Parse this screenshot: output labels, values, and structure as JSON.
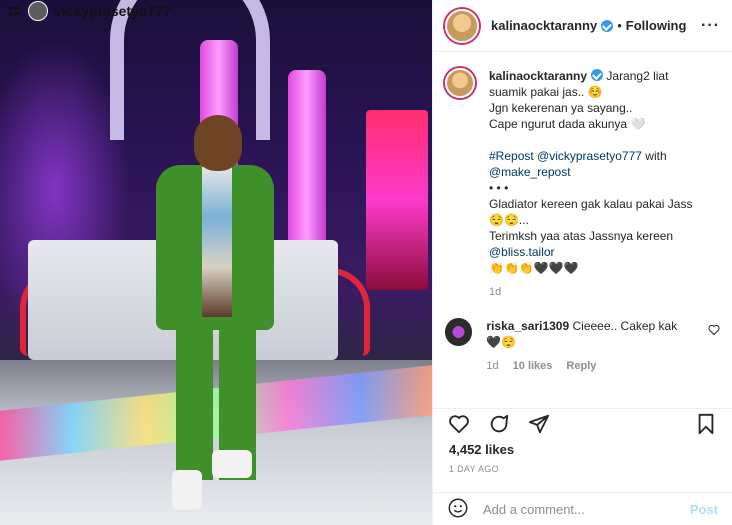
{
  "repost": {
    "username": "vickyprasetyo777",
    "icon": "repost-icon"
  },
  "header": {
    "username": "kalinaocktaranny",
    "separator": "•",
    "following_label": "Following",
    "more_label": "···"
  },
  "caption": {
    "username": "kalinaocktaranny",
    "line1": "Jarang2 liat suamik pakai jas.. ☺️",
    "line2": "Jgn kekerenan ya sayang..",
    "line3": "Cape ngurut dada akunya 🤍",
    "repost_tag": "#Repost @vickyprasetyo777",
    "with_text": "with",
    "make_repost": "@make_repost",
    "dots": "• • •",
    "line4": "Gladiator kereen gak kalau pakai Jass 😌😌...",
    "line5": "Terimksh yaa atas Jassnya kereen",
    "tailor": "@bliss.tailor",
    "emojis": "👏👏👏🖤🖤🖤",
    "time": "1d"
  },
  "comment": {
    "username": "riska_sari1309",
    "text": "Cieeee.. Cakep kak 🖤😌",
    "time": "1d",
    "likes": "10 likes",
    "reply": "Reply"
  },
  "actions": {
    "likes": "4,452 likes",
    "date": "1 DAY AGO"
  },
  "add_comment": {
    "placeholder": "Add a comment...",
    "post_label": "Post"
  },
  "colors": {
    "accent": "#3897f0",
    "link": "#00376b",
    "muted": "#8e8e8e",
    "post_disabled": "#b2dffc"
  }
}
